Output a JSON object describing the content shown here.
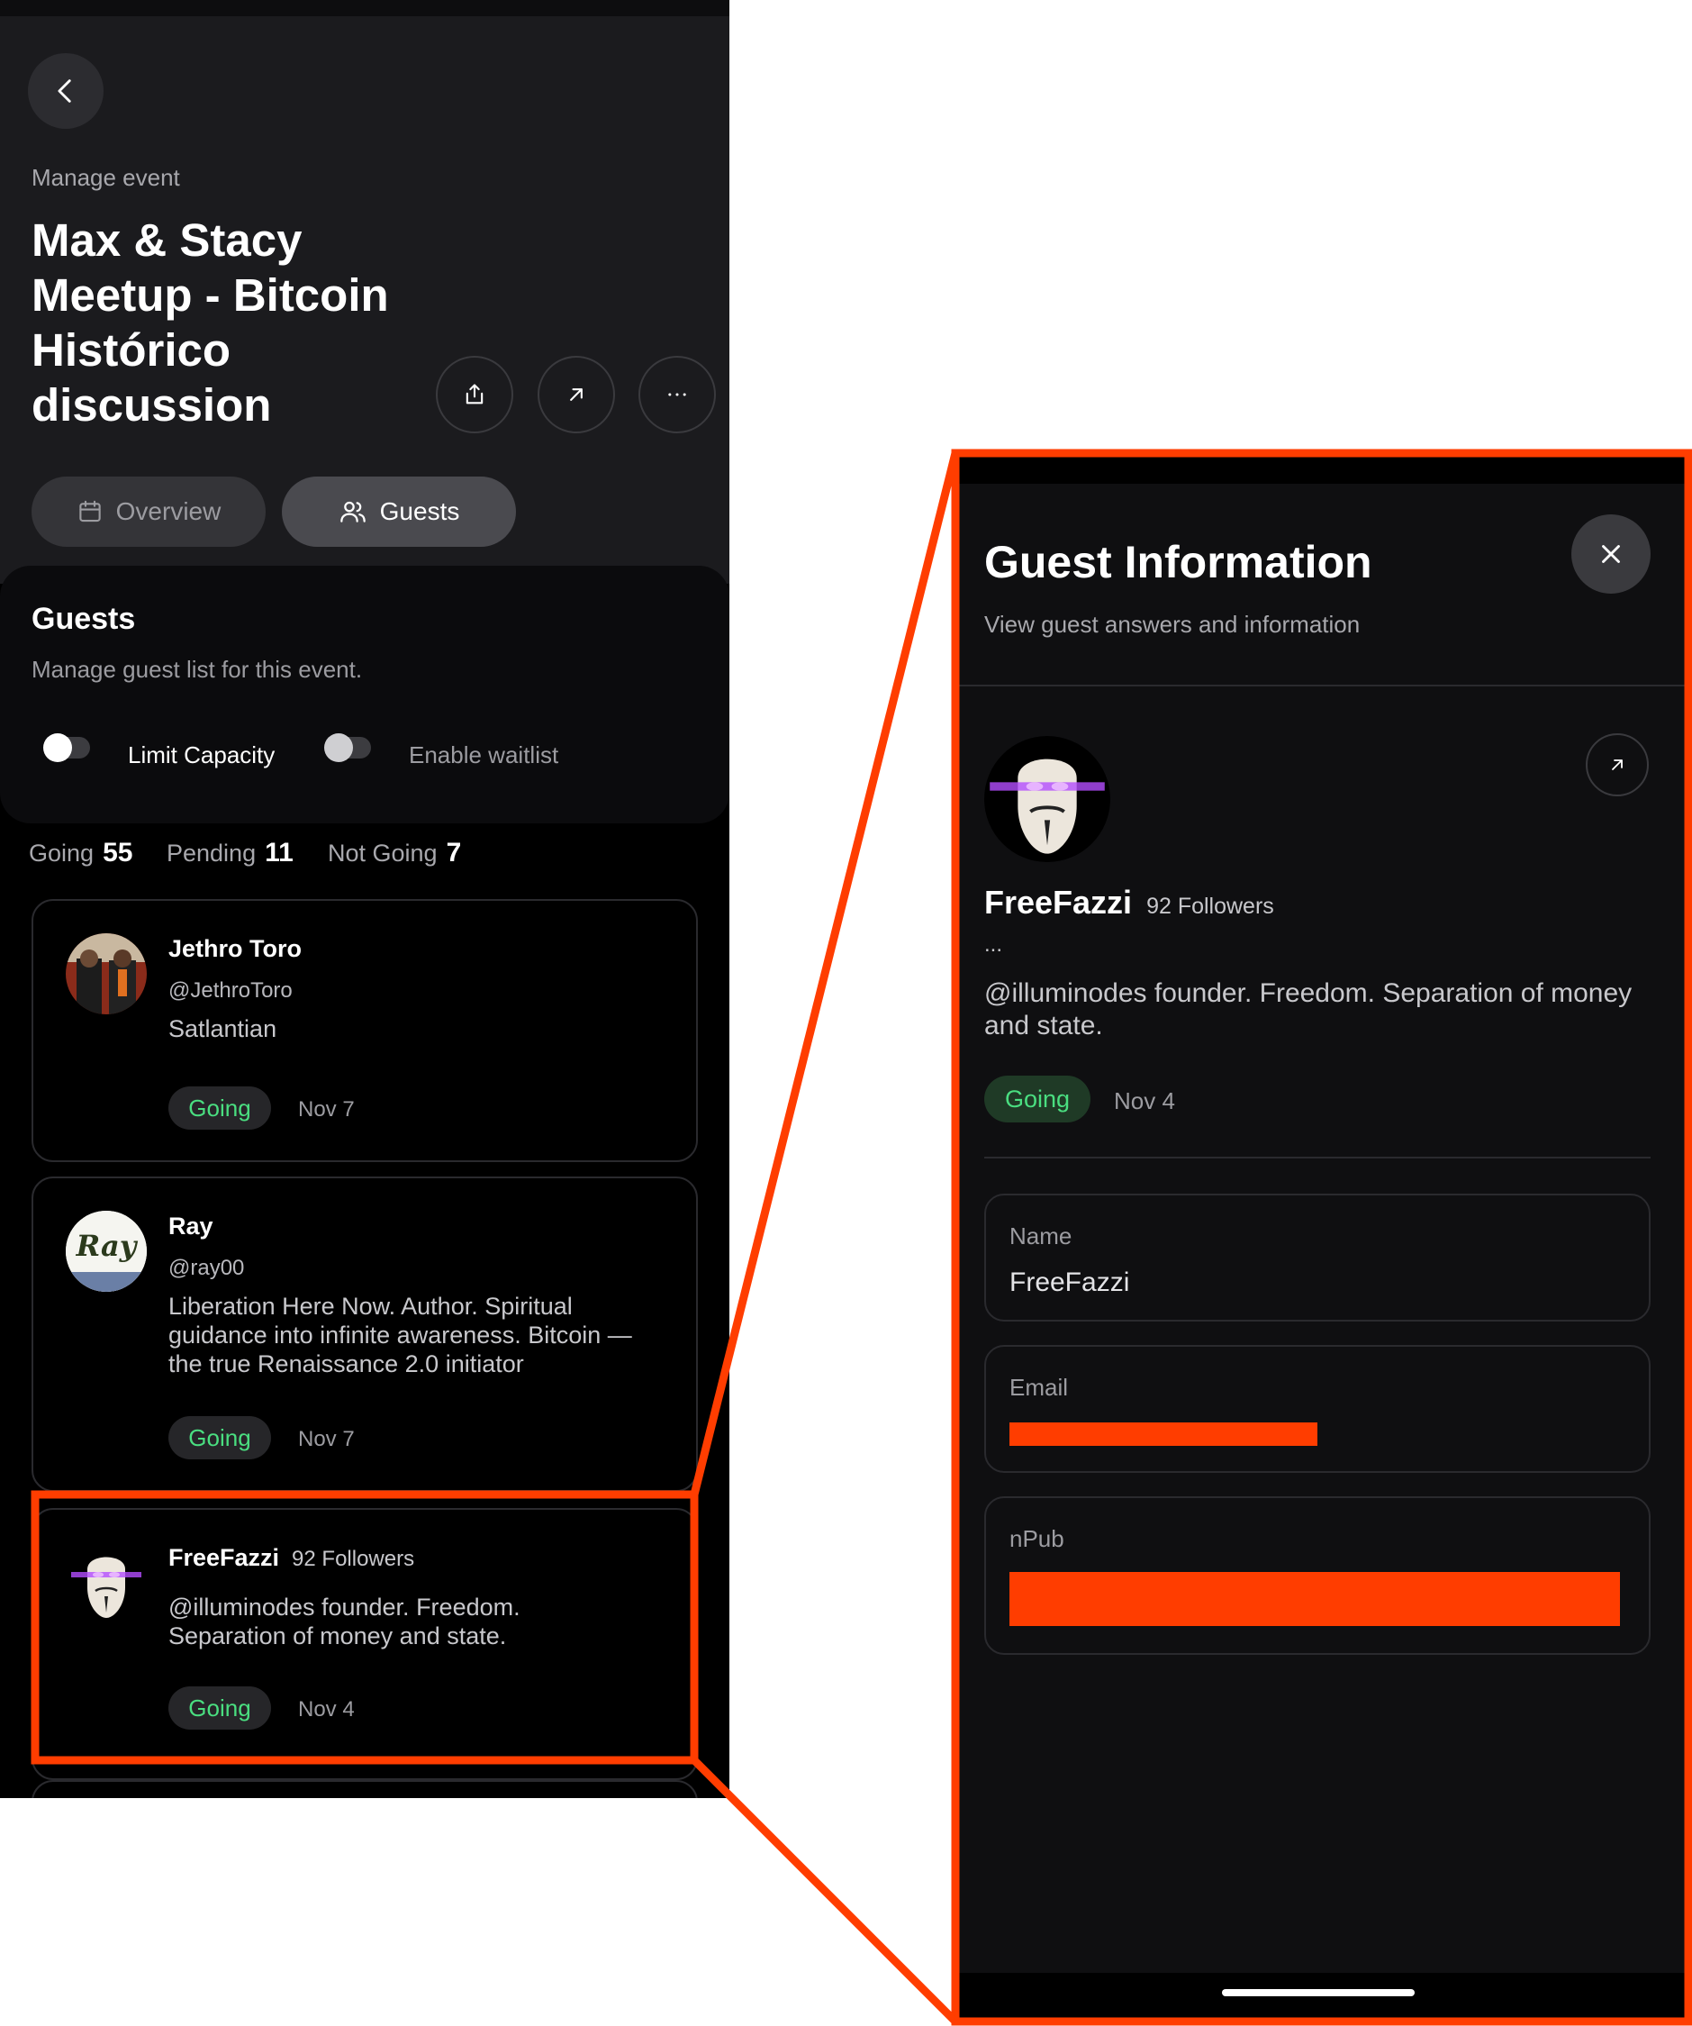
{
  "event": {
    "manage_label": "Manage event",
    "title": "Max & Stacy Meetup - Bitcoin Histórico discussion",
    "tabs": {
      "overview": "Overview",
      "guests": "Guests"
    }
  },
  "guests_section": {
    "heading": "Guests",
    "subtitle": "Manage guest list for this event.",
    "limit_capacity_label": "Limit Capacity",
    "enable_waitlist_label": "Enable waitlist"
  },
  "counts": {
    "going_label": "Going",
    "going_value": "55",
    "pending_label": "Pending",
    "pending_value": "11",
    "not_going_label": "Not Going",
    "not_going_value": "7"
  },
  "guests": [
    {
      "name": "Jethro Toro",
      "handle": "@JethroToro",
      "bio": "Satlantian",
      "status": "Going",
      "date": "Nov 7"
    },
    {
      "name": "Ray",
      "handle": "@ray00",
      "bio": "Liberation Here Now. Author. Spiritual guidance into infinite awareness. Bitcoin — the true Renaissance 2.0 initiator",
      "status": "Going",
      "date": "Nov 7",
      "avatar_text": "Ray"
    },
    {
      "name": "FreeFazzi",
      "followers": "92 Followers",
      "bio": "@illuminodes founder. Freedom. Separation of money and state.",
      "status": "Going",
      "date": "Nov 4"
    }
  ],
  "guest_info": {
    "title": "Guest Information",
    "subtitle": "View guest answers and information",
    "name": "FreeFazzi",
    "followers": "92 Followers",
    "ellipsis": "...",
    "bio": "@illuminodes founder. Freedom. Separation of money and state.",
    "status": "Going",
    "date": "Nov 4",
    "fields": {
      "name_label": "Name",
      "name_value": "FreeFazzi",
      "email_label": "Email",
      "npub_label": "nPub"
    }
  },
  "colors": {
    "highlight": "#ff3d00",
    "going_green": "#4ade80"
  },
  "icons": [
    "back-icon",
    "share-icon",
    "external-link-icon",
    "more-icon",
    "calendar-icon",
    "users-icon",
    "close-icon"
  ]
}
